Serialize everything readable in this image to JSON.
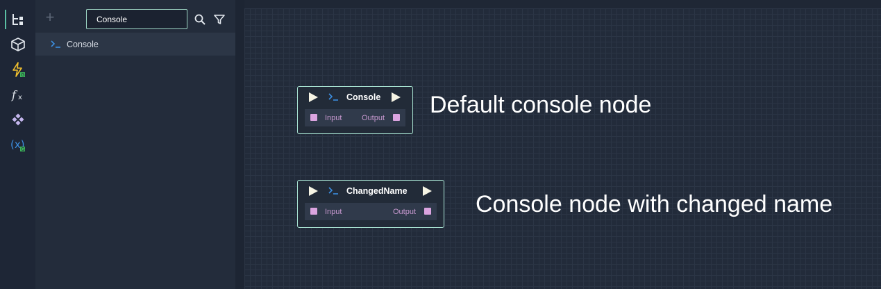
{
  "search": {
    "value": "Console"
  },
  "results": [
    {
      "label": "Console"
    }
  ],
  "nodes": [
    {
      "title": "Console",
      "input_label": "Input",
      "output_label": "Output"
    },
    {
      "title": "ChangedName",
      "input_label": "Input",
      "output_label": "Output"
    }
  ],
  "captions": [
    "Default console node",
    "Console node with changed name"
  ],
  "icons": {
    "rail": [
      "hierarchy-icon",
      "cube-icon",
      "lightning-g-icon",
      "function-icon",
      "diamonds-icon",
      "variable-g-icon"
    ],
    "toolbar": [
      "add-icon",
      "search-icon",
      "filter-icon"
    ],
    "node": [
      "exec-in-icon",
      "console-icon",
      "exec-out-icon"
    ]
  },
  "colors": {
    "accent": "#5bc0a4",
    "node_border": "#a8e3d2",
    "port": "#dba4e0",
    "console_icon": "#3c8ee0",
    "lightning": "#f2c12e",
    "g_badge": "#3cb55a"
  }
}
